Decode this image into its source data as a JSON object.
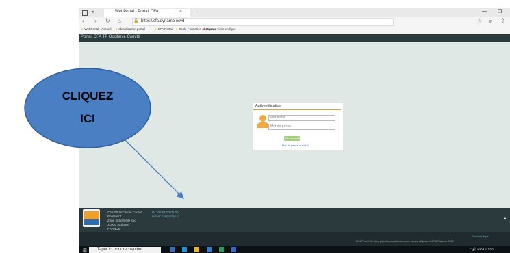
{
  "browser": {
    "tab_title": "WebPortal - Portail CFA",
    "tab_close": "×",
    "tab_new": "+",
    "url": "https://cfa.dynamo.ocvd",
    "minimize": "—",
    "maximize": "❐"
  },
  "favorites": [
    "WebPortal - Accueil",
    "Identification portail",
    "CFA Portail",
    "Ecole Formation Alternance",
    "Espace visite en ligne"
  ],
  "site": {
    "header_title": "Portail CFA TP Occitanie Comité"
  },
  "login": {
    "title": "Authentification",
    "username_placeholder": "Identifiant",
    "password_placeholder": "Mot de passe",
    "submit": "Se connecter",
    "forgot": "Mot de passe oublié ?"
  },
  "footer": {
    "address_lines": [
      "CFA TP Occitanie Comité",
      "Boulevard",
      "Zone Industrielle sud",
      "31000 Toulouse",
      "FRANCE"
    ],
    "contact_lines": [
      "tél : 05 61 00 00 00",
      "email : cfa@cfatp.fr"
    ],
    "back_to_top": "▲",
    "bottom_right_1": "Contact légal",
    "bottom_right_2": "WebPortal Version, plus Compatible Internet version Opera et CFA Plateau 2019"
  },
  "taskbar": {
    "search_placeholder": "Taper ici pour rechercher",
    "tray_text": "^ 🔊 FRA 10:55"
  },
  "callout": {
    "line1": "CLIQUEZ",
    "line2": "ICI"
  },
  "colors": {
    "callout_fill": "#4a7fc4",
    "page_bg": "#dfe8e5",
    "header_bg": "#2b3a3d",
    "accent": "#e0a43c",
    "button": "#a6cf79"
  }
}
